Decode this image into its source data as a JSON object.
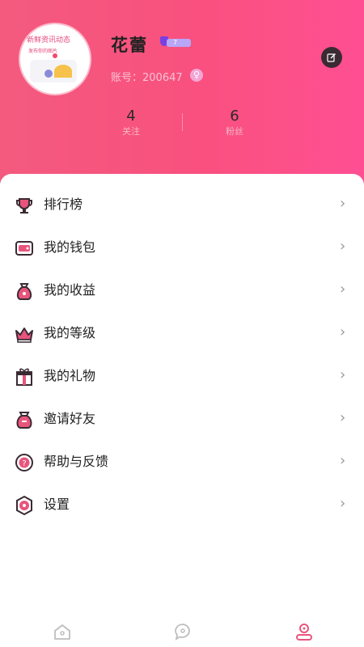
{
  "profile": {
    "avatar_text_line1": "新鲜资讯动态",
    "avatar_text_line2": "发布你的图片",
    "name": "花蕾",
    "level": "7",
    "account": "账号：200647",
    "gender_symbol": "♀"
  },
  "stats": {
    "following": {
      "count": "4",
      "label": "关注"
    },
    "fans": {
      "count": "6",
      "label": "粉丝"
    }
  },
  "menu": [
    {
      "label": "排行榜",
      "icon": "trophy-icon"
    },
    {
      "label": "我的钱包",
      "icon": "wallet-icon"
    },
    {
      "label": "我的收益",
      "icon": "money-bag-icon"
    },
    {
      "label": "我的等级",
      "icon": "crown-icon"
    },
    {
      "label": "我的礼物",
      "icon": "gift-icon"
    },
    {
      "label": "邀请好友",
      "icon": "invite-icon"
    },
    {
      "label": "帮助与反馈",
      "icon": "help-icon"
    },
    {
      "label": "设置",
      "icon": "settings-icon"
    }
  ],
  "tabbar": {
    "active": "mine"
  },
  "colors": {
    "accent": "#e8557c",
    "dark": "#3a2b33",
    "header_start": "#f35a7e",
    "header_end": "#ff4f93"
  }
}
